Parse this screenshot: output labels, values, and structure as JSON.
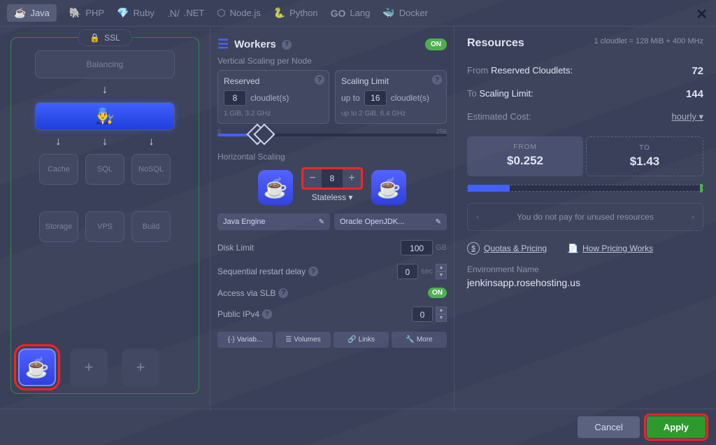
{
  "tabs": {
    "java": "Java",
    "php": "PHP",
    "ruby": "Ruby",
    "dotnet": ".NET",
    "nodejs": "Node.js",
    "python": "Python",
    "lang": "Lang",
    "docker": "Docker"
  },
  "ssl": {
    "label": "SSL"
  },
  "topology": {
    "balancing": "Balancing",
    "cache": "Cache",
    "sql": "SQL",
    "nosql": "NoSQL",
    "storage": "Storage",
    "vps": "VPS",
    "build": "Build",
    "plus": "+"
  },
  "workers": {
    "title": "Workers",
    "on": "ON",
    "vscale_label": "Vertical Scaling per Node",
    "reserved": {
      "title": "Reserved",
      "value": "8",
      "unit": "cloudlet(s)",
      "sub": "1 GiB, 3.2 GHz"
    },
    "limit": {
      "title": "Scaling Limit",
      "prefix": "up to",
      "value": "16",
      "unit": "cloudlet(s)",
      "sub_prefix": "up to",
      "sub": "2 GiB, 6.4 GHz"
    },
    "slider": {
      "min": "0",
      "max": "256"
    },
    "hscale_label": "Horizontal Scaling",
    "hscale_value": "8",
    "stateless": "Stateless",
    "engine_left": "Java Engine",
    "engine_right": "Oracle OpenJDK...",
    "disk_limit": {
      "label": "Disk Limit",
      "value": "100",
      "unit": "GB"
    },
    "restart": {
      "label": "Sequential restart delay",
      "value": "0",
      "unit": "sec"
    },
    "slb": {
      "label": "Access via SLB",
      "badge": "ON"
    },
    "ipv4": {
      "label": "Public IPv4",
      "value": "0"
    },
    "actions": {
      "variables": "Variab...",
      "volumes": "Volumes",
      "links": "Links",
      "more": "More"
    }
  },
  "resources": {
    "title": "Resources",
    "subtitle": "1 cloudlet = 128 MiB + 400 MHz",
    "from_label_pre": "From",
    "from_label": "Reserved Cloudlets:",
    "from_val": "72",
    "to_label_pre": "To",
    "to_label": "Scaling Limit:",
    "to_val": "144",
    "cost_label": "Estimated Cost:",
    "cost_period": "hourly",
    "from_card": {
      "label": "FROM",
      "value": "$0.252"
    },
    "to_card": {
      "label": "TO",
      "value": "$1.43"
    },
    "banner": "You do not pay for unused resources",
    "quotas_link": "Quotas & Pricing",
    "pricing_link": "How Pricing Works",
    "env_label": "Environment Name",
    "env_value": "jenkinsapp.rosehosting.us"
  },
  "footer": {
    "cancel": "Cancel",
    "apply": "Apply"
  }
}
